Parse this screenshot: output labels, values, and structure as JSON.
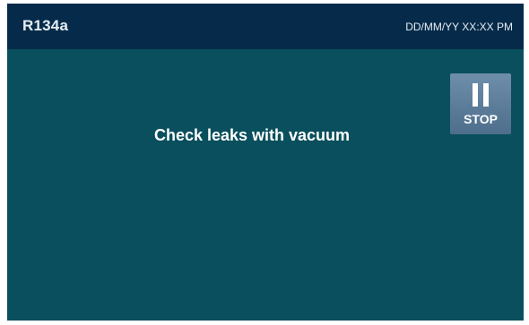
{
  "header": {
    "title": "R134a",
    "datetime": "DD/MM/YY XX:XX PM"
  },
  "main": {
    "message": "Check leaks with vacuum"
  },
  "stop_button": {
    "label": "STOP",
    "icon": "pause-icon"
  },
  "colors": {
    "header_bg": "#062b4a",
    "screen_bg": "#094f5d",
    "button_bg": "#5a7b98",
    "text": "#ffffff"
  }
}
